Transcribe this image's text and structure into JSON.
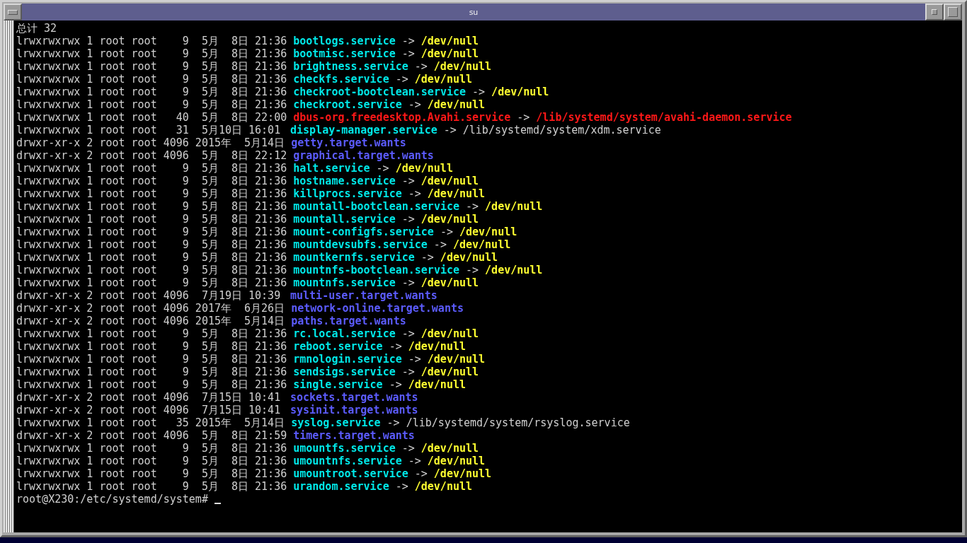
{
  "window": {
    "title": "su"
  },
  "total": "总计 32",
  "entries": [
    {
      "info": "lrwxrwxrwx 1 root root    9  5月  8日 21:36",
      "name": "bootlogs.service",
      "kind": "symlink",
      "arrow": "->",
      "target": "/dev/null",
      "target_is_device": true
    },
    {
      "info": "lrwxrwxrwx 1 root root    9  5月  8日 21:36",
      "name": "bootmisc.service",
      "kind": "symlink",
      "arrow": "->",
      "target": "/dev/null",
      "target_is_device": true
    },
    {
      "info": "lrwxrwxrwx 1 root root    9  5月  8日 21:36",
      "name": "brightness.service",
      "kind": "symlink",
      "arrow": "->",
      "target": "/dev/null",
      "target_is_device": true
    },
    {
      "info": "lrwxrwxrwx 1 root root    9  5月  8日 21:36",
      "name": "checkfs.service",
      "kind": "symlink",
      "arrow": "->",
      "target": "/dev/null",
      "target_is_device": true
    },
    {
      "info": "lrwxrwxrwx 1 root root    9  5月  8日 21:36",
      "name": "checkroot-bootclean.service",
      "kind": "symlink",
      "arrow": "->",
      "target": "/dev/null",
      "target_is_device": true
    },
    {
      "info": "lrwxrwxrwx 1 root root    9  5月  8日 21:36",
      "name": "checkroot.service",
      "kind": "symlink",
      "arrow": "->",
      "target": "/dev/null",
      "target_is_device": true
    },
    {
      "info": "lrwxrwxrwx 1 root root   40  5月  8日 22:00",
      "name": "dbus-org.freedesktop.Avahi.service",
      "kind": "broken",
      "arrow": "->",
      "target": "/lib/systemd/system/avahi-daemon.service"
    },
    {
      "info": "lrwxrwxrwx 1 root root   31  5月10日 16:01",
      "name": "display-manager.service",
      "kind": "symlink",
      "arrow": "->",
      "target": "/lib/systemd/system/xdm.service",
      "target_is_device": false
    },
    {
      "info": "drwxr-xr-x 2 root root 4096 2015年  5月14日",
      "name": "getty.target.wants",
      "kind": "dir"
    },
    {
      "info": "drwxr-xr-x 2 root root 4096  5月  8日 22:12",
      "name": "graphical.target.wants",
      "kind": "dir"
    },
    {
      "info": "lrwxrwxrwx 1 root root    9  5月  8日 21:36",
      "name": "halt.service",
      "kind": "symlink",
      "arrow": "->",
      "target": "/dev/null",
      "target_is_device": true
    },
    {
      "info": "lrwxrwxrwx 1 root root    9  5月  8日 21:36",
      "name": "hostname.service",
      "kind": "symlink",
      "arrow": "->",
      "target": "/dev/null",
      "target_is_device": true
    },
    {
      "info": "lrwxrwxrwx 1 root root    9  5月  8日 21:36",
      "name": "killprocs.service",
      "kind": "symlink",
      "arrow": "->",
      "target": "/dev/null",
      "target_is_device": true
    },
    {
      "info": "lrwxrwxrwx 1 root root    9  5月  8日 21:36",
      "name": "mountall-bootclean.service",
      "kind": "symlink",
      "arrow": "->",
      "target": "/dev/null",
      "target_is_device": true
    },
    {
      "info": "lrwxrwxrwx 1 root root    9  5月  8日 21:36",
      "name": "mountall.service",
      "kind": "symlink",
      "arrow": "->",
      "target": "/dev/null",
      "target_is_device": true
    },
    {
      "info": "lrwxrwxrwx 1 root root    9  5月  8日 21:36",
      "name": "mount-configfs.service",
      "kind": "symlink",
      "arrow": "->",
      "target": "/dev/null",
      "target_is_device": true
    },
    {
      "info": "lrwxrwxrwx 1 root root    9  5月  8日 21:36",
      "name": "mountdevsubfs.service",
      "kind": "symlink",
      "arrow": "->",
      "target": "/dev/null",
      "target_is_device": true
    },
    {
      "info": "lrwxrwxrwx 1 root root    9  5月  8日 21:36",
      "name": "mountkernfs.service",
      "kind": "symlink",
      "arrow": "->",
      "target": "/dev/null",
      "target_is_device": true
    },
    {
      "info": "lrwxrwxrwx 1 root root    9  5月  8日 21:36",
      "name": "mountnfs-bootclean.service",
      "kind": "symlink",
      "arrow": "->",
      "target": "/dev/null",
      "target_is_device": true
    },
    {
      "info": "lrwxrwxrwx 1 root root    9  5月  8日 21:36",
      "name": "mountnfs.service",
      "kind": "symlink",
      "arrow": "->",
      "target": "/dev/null",
      "target_is_device": true
    },
    {
      "info": "drwxr-xr-x 2 root root 4096  7月19日 10:39",
      "name": "multi-user.target.wants",
      "kind": "dir"
    },
    {
      "info": "drwxr-xr-x 2 root root 4096 2017年  6月26日",
      "name": "network-online.target.wants",
      "kind": "dir"
    },
    {
      "info": "drwxr-xr-x 2 root root 4096 2015年  5月14日",
      "name": "paths.target.wants",
      "kind": "dir"
    },
    {
      "info": "lrwxrwxrwx 1 root root    9  5月  8日 21:36",
      "name": "rc.local.service",
      "kind": "symlink",
      "arrow": "->",
      "target": "/dev/null",
      "target_is_device": true
    },
    {
      "info": "lrwxrwxrwx 1 root root    9  5月  8日 21:36",
      "name": "reboot.service",
      "kind": "symlink",
      "arrow": "->",
      "target": "/dev/null",
      "target_is_device": true
    },
    {
      "info": "lrwxrwxrwx 1 root root    9  5月  8日 21:36",
      "name": "rmnologin.service",
      "kind": "symlink",
      "arrow": "->",
      "target": "/dev/null",
      "target_is_device": true
    },
    {
      "info": "lrwxrwxrwx 1 root root    9  5月  8日 21:36",
      "name": "sendsigs.service",
      "kind": "symlink",
      "arrow": "->",
      "target": "/dev/null",
      "target_is_device": true
    },
    {
      "info": "lrwxrwxrwx 1 root root    9  5月  8日 21:36",
      "name": "single.service",
      "kind": "symlink",
      "arrow": "->",
      "target": "/dev/null",
      "target_is_device": true
    },
    {
      "info": "drwxr-xr-x 2 root root 4096  7月15日 10:41",
      "name": "sockets.target.wants",
      "kind": "dir"
    },
    {
      "info": "drwxr-xr-x 2 root root 4096  7月15日 10:41",
      "name": "sysinit.target.wants",
      "kind": "dir"
    },
    {
      "info": "lrwxrwxrwx 1 root root   35 2015年  5月14日",
      "name": "syslog.service",
      "kind": "symlink",
      "arrow": "->",
      "target": "/lib/systemd/system/rsyslog.service",
      "target_is_device": false
    },
    {
      "info": "drwxr-xr-x 2 root root 4096  5月  8日 21:59",
      "name": "timers.target.wants",
      "kind": "dir"
    },
    {
      "info": "lrwxrwxrwx 1 root root    9  5月  8日 21:36",
      "name": "umountfs.service",
      "kind": "symlink",
      "arrow": "->",
      "target": "/dev/null",
      "target_is_device": true
    },
    {
      "info": "lrwxrwxrwx 1 root root    9  5月  8日 21:36",
      "name": "umountnfs.service",
      "kind": "symlink",
      "arrow": "->",
      "target": "/dev/null",
      "target_is_device": true
    },
    {
      "info": "lrwxrwxrwx 1 root root    9  5月  8日 21:36",
      "name": "umountroot.service",
      "kind": "symlink",
      "arrow": "->",
      "target": "/dev/null",
      "target_is_device": true
    },
    {
      "info": "lrwxrwxrwx 1 root root    9  5月  8日 21:36",
      "name": "urandom.service",
      "kind": "symlink",
      "arrow": "->",
      "target": "/dev/null",
      "target_is_device": true
    }
  ],
  "prompt": "root@X230:/etc/systemd/system#"
}
